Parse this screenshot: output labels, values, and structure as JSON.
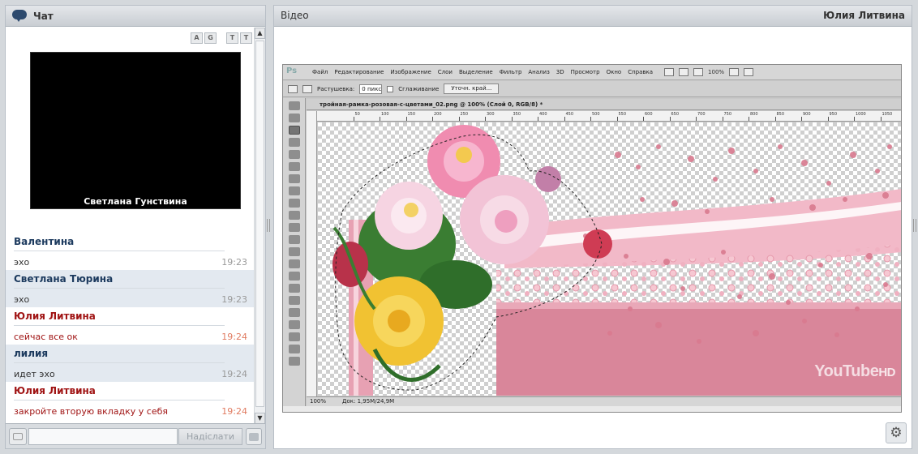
{
  "chat": {
    "title": "Чат",
    "webcam_user": "Светлана  Гунствина",
    "tool_labels": [
      "A",
      "G",
      "T",
      "T"
    ],
    "messages": [
      {
        "author": "Валентина",
        "text": "эхо",
        "time": "19:23",
        "style": "blue",
        "alt": false
      },
      {
        "author": "Светлана Тюрина",
        "text": "эхо",
        "time": "19:23",
        "style": "blue",
        "alt": true
      },
      {
        "author": "Юлия Литвина",
        "text": "сейчас все ок",
        "time": "19:24",
        "style": "red",
        "alt": false
      },
      {
        "author": "лилия",
        "text": "идет эхо",
        "time": "19:24",
        "style": "blue",
        "alt": true
      },
      {
        "author": "Юлия Литвина",
        "text": "закройте вторую вкладку у себя",
        "time": "19:24",
        "style": "red",
        "alt": false
      }
    ],
    "input_value": "",
    "send_label": "Надіслати"
  },
  "video": {
    "title": "Відео",
    "owner": "Юлия Литвина"
  },
  "photoshop": {
    "logo": "Ps",
    "menu": [
      "Файл",
      "Редактирование",
      "Изображение",
      "Слои",
      "Выделение",
      "Фильтр",
      "Анализ",
      "3D",
      "Просмотр",
      "Окно",
      "Справка"
    ],
    "zoom_menu": "100%",
    "feather_label": "Растушевка:",
    "feather_value": "0 пикс",
    "antialias_label": "Сглаживание",
    "refine_button": "Уточн. край...",
    "document_tab": "тройная-рамка-розовая-с-цветами_02.png @ 100% (Слой 0, RGB/8) *",
    "ruler_numbers": [
      "50",
      "100",
      "150",
      "200",
      "250",
      "300",
      "350",
      "400",
      "450",
      "500",
      "550",
      "600",
      "650",
      "700",
      "750",
      "800",
      "850",
      "900",
      "950",
      "1000",
      "1050",
      "1100"
    ],
    "status_zoom": "100%",
    "status_doc": "Док: 1,95M/24,9M"
  },
  "watermark": {
    "you": "YouTube",
    "hd": "HD"
  },
  "colors": {
    "author_blue": "#1c3a5e",
    "author_red": "#a01414",
    "alt_row": "#e3e9f0",
    "pink_frame": "#d9869a"
  },
  "icons": {
    "chat": "speech-bubble-icon",
    "settings": "gear-icon",
    "smile": "emoticon-icon",
    "clear": "clear-chat-icon"
  }
}
